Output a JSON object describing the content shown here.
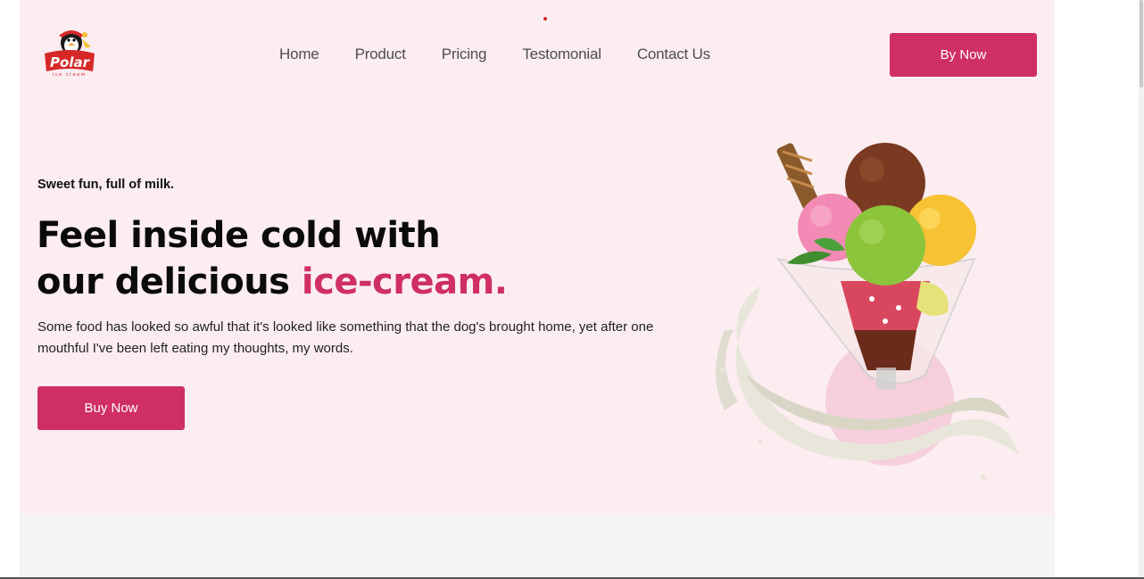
{
  "brand": {
    "logo_text": "Polar",
    "logo_subtext": "ice cream"
  },
  "nav": {
    "items": [
      "Home",
      "Product",
      "Pricing",
      "Testomonial",
      "Contact Us"
    ]
  },
  "header": {
    "cta_label": "By Now"
  },
  "hero": {
    "tagline": "Sweet fun, full of milk.",
    "headline_line1": "Feel inside cold with",
    "headline_line2_prefix": "our delicious ",
    "headline_line2_accent": "ice-cream.",
    "description": "Some food has looked so awful that it's looked like something that the dog's brought home, yet after one mouthful I've been left eating my thoughts, my words.",
    "cta_label": "Buy Now",
    "image_icon": "ice-cream-sundae-icon"
  },
  "colors": {
    "accent": "#cf2f62",
    "hero_bg": "#fcedf1",
    "section_bg": "#f4f4f4"
  }
}
